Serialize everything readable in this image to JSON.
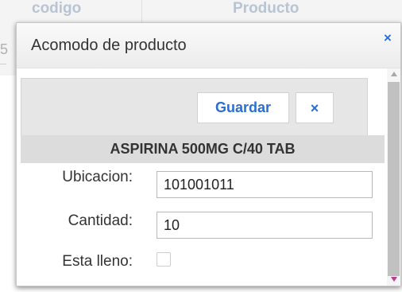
{
  "background_table": {
    "col_codigo": "codigo",
    "col_producto": "Producto",
    "edge_number": "5"
  },
  "dialog": {
    "title": "Acomodo de producto",
    "close_icon": "×"
  },
  "toolbar": {
    "save_label": "Guardar",
    "cancel_icon": "×"
  },
  "product": {
    "name": "ASPIRINA 500MG C/40 TAB"
  },
  "form": {
    "ubicacion_label": "Ubicacion:",
    "ubicacion_value": "101001011",
    "cantidad_label": "Cantidad:",
    "cantidad_value": "10",
    "lleno_label": "Esta lleno:",
    "lleno_checked": false
  },
  "colors": {
    "accent": "#2a6ecf",
    "toolbar_bg": "#e6e6e6",
    "product_bar_bg": "#dcdcdc"
  },
  "icons": [
    "close-icon",
    "cancel-icon",
    "scroll-up-icon",
    "scroll-down-icon"
  ]
}
